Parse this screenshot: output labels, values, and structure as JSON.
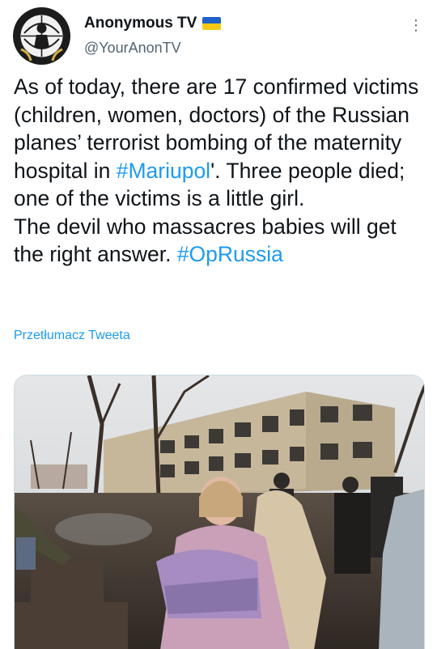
{
  "author": {
    "display_name": "Anonymous TV",
    "handle": "@YourAnonTV",
    "verified_flag": "ukraine-flag"
  },
  "tweet": {
    "seg1": "As of today, there are 17 confirmed victims (children, women, doctors) of the Russian planes’ terrorist bombing of the maternity hospital in ",
    "hashtag1": "#Mariupol",
    "seg2": "'. Three people died; one of the victims is a little girl.",
    "seg3": "The devil who massacres babies will get the right answer. ",
    "hashtag2": "#OpRussia"
  },
  "translate_label": "Przetłumacz Tweeta",
  "more_icon_glyph": "⋮",
  "colors": {
    "link": "#1d9bf0",
    "text": "#0f1419",
    "secondary": "#536471",
    "flag_blue": "#1f62c7",
    "flag_yellow": "#f6c915"
  }
}
